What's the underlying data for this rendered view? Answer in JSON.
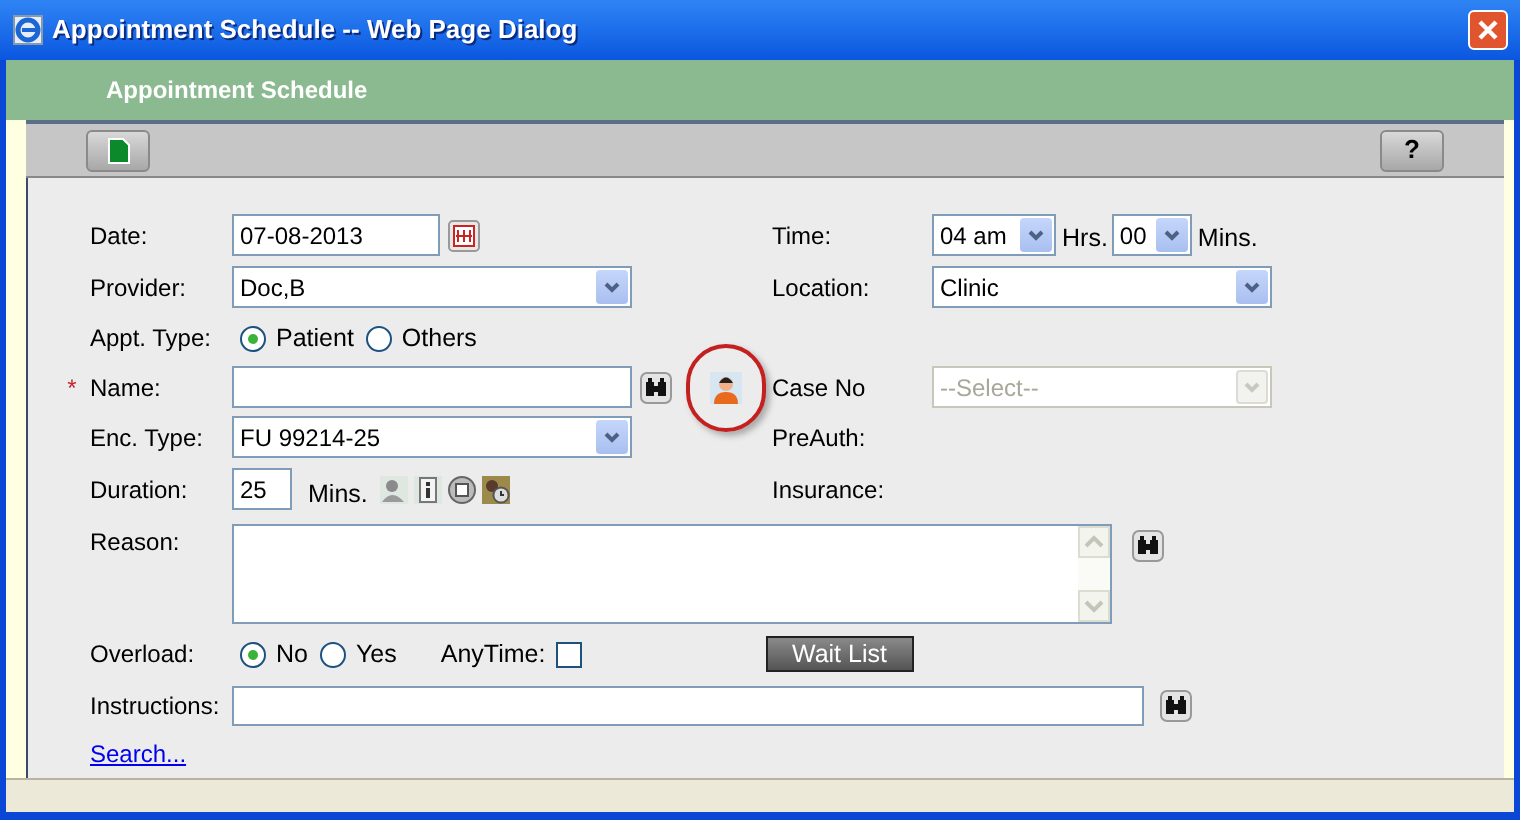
{
  "window": {
    "title": "Appointment Schedule -- Web Page Dialog"
  },
  "header": {
    "title": "Appointment Schedule"
  },
  "toolbar": {
    "buttons": [
      {
        "kind": "new"
      },
      {
        "kind": "help",
        "label": "?"
      }
    ]
  },
  "date": {
    "label": "Date:",
    "value": "07-08-2013"
  },
  "time": {
    "label": "Time:",
    "hours": "04 am",
    "hours_unit": "Hrs.",
    "minutes": "00",
    "minutes_unit": "Mins."
  },
  "provider": {
    "label": "Provider:",
    "value": "Doc,B"
  },
  "location": {
    "label": "Location:",
    "value": "Clinic"
  },
  "appt_type": {
    "label": "Appt. Type:",
    "options": [
      {
        "label": "Patient",
        "selected": true
      },
      {
        "label": "Others",
        "selected": false
      }
    ]
  },
  "name": {
    "label": "Name:",
    "required_mark": "*"
  },
  "case_no": {
    "label": "Case No",
    "placeholder": "--Select--",
    "disabled": true
  },
  "enc_type": {
    "label": "Enc. Type:",
    "value": "FU 99214-25"
  },
  "preauth": {
    "label": "PreAuth:"
  },
  "duration": {
    "label": "Duration:",
    "value": "25",
    "unit": "Mins."
  },
  "insurance": {
    "label": "Insurance:"
  },
  "reason": {
    "label": "Reason:"
  },
  "overload": {
    "label": "Overload:",
    "options": [
      {
        "label": "No",
        "selected": true
      },
      {
        "label": "Yes",
        "selected": false
      }
    ]
  },
  "anytime": {
    "label": "AnyTime:",
    "checked": false
  },
  "wait_list_button": {
    "label": "Wait List"
  },
  "instructions": {
    "label": "Instructions:"
  },
  "search_link": {
    "label": "Search..."
  }
}
